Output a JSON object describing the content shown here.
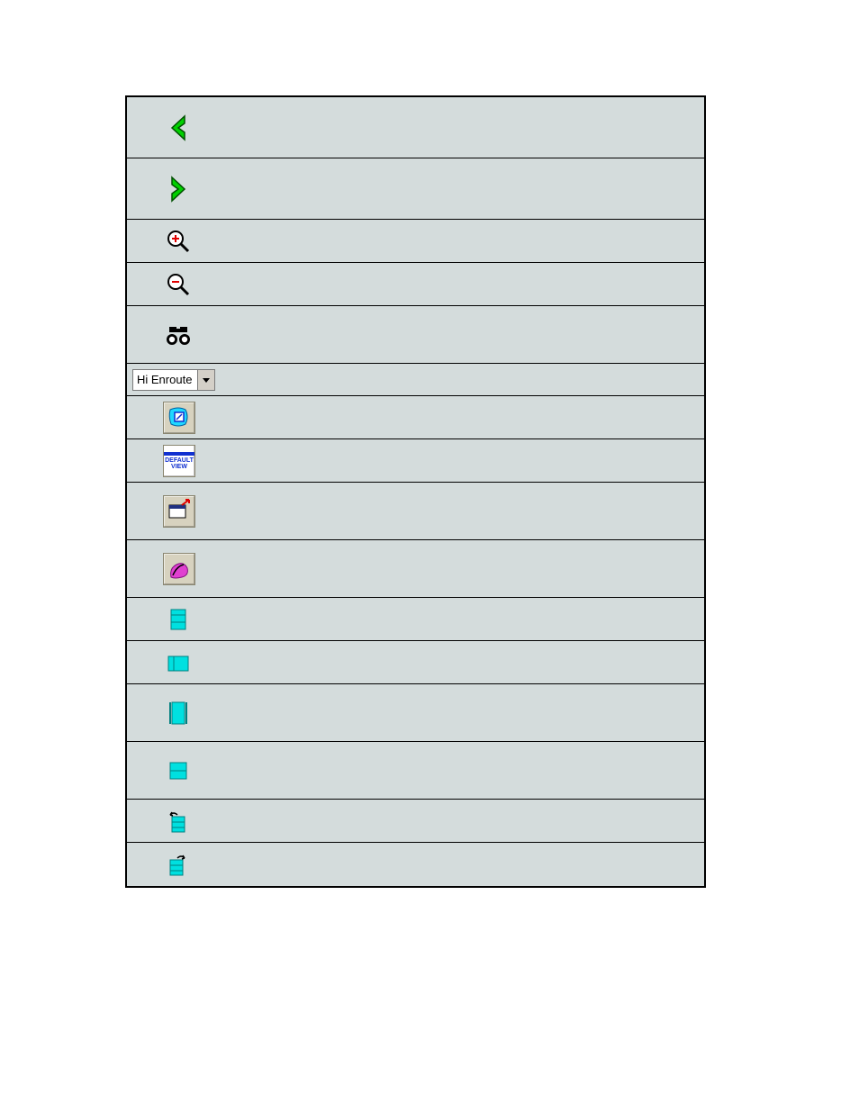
{
  "toolbar": {
    "rows": [
      {
        "name": "back-button",
        "icon": "chevron-left-icon"
      },
      {
        "name": "forward-button",
        "icon": "chevron-right-icon"
      },
      {
        "name": "zoom-in-button",
        "icon": "zoom-in-icon"
      },
      {
        "name": "zoom-out-button",
        "icon": "zoom-out-icon"
      },
      {
        "name": "find-button",
        "icon": "binoculars-icon"
      }
    ],
    "dropdown": {
      "selected": "Hi Enroute"
    },
    "rows2": [
      {
        "name": "region-map-button",
        "icon": "map-region-icon"
      },
      {
        "name": "default-view-button",
        "icon": "default-view-icon",
        "label_top": "DEFAULT",
        "label_bot": "VIEW"
      },
      {
        "name": "open-window-button",
        "icon": "window-popout-icon"
      },
      {
        "name": "route-tool-button",
        "icon": "route-tool-icon"
      },
      {
        "name": "block-top-button",
        "icon": "block-top-icon"
      },
      {
        "name": "block-left-button",
        "icon": "block-left-icon"
      },
      {
        "name": "block-vertical-button",
        "icon": "block-vertical-icon"
      },
      {
        "name": "block-split-button",
        "icon": "block-split-icon"
      },
      {
        "name": "undo-block-button",
        "icon": "undo-block-icon"
      },
      {
        "name": "redo-block-button",
        "icon": "redo-block-icon"
      }
    ]
  },
  "colors": {
    "green": "#00d000",
    "cyan": "#00e0e0",
    "magenta": "#d030c0",
    "blue": "#1030d0",
    "red": "#e00000"
  }
}
